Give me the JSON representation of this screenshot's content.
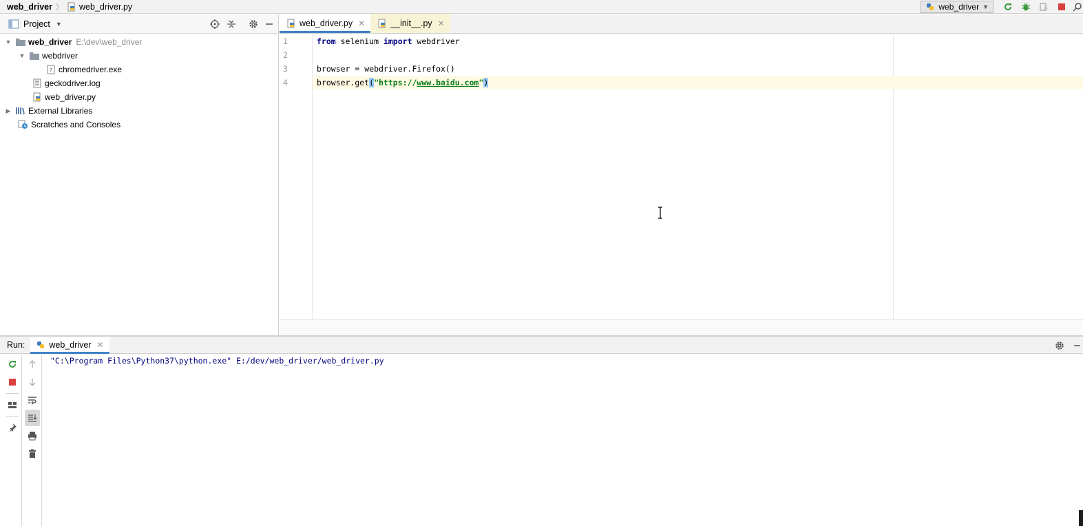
{
  "navbar": {
    "project_name": "web_driver",
    "current_file": "web_driver.py",
    "run_config": "web_driver"
  },
  "project_panel": {
    "title": "Project",
    "tree": [
      {
        "label": "web_driver",
        "path": "E:\\dev\\web_driver",
        "level": 0,
        "expanded": true,
        "type": "folder"
      },
      {
        "label": "webdriver",
        "level": 1,
        "expanded": true,
        "type": "folder"
      },
      {
        "label": "chromedriver.exe",
        "level": 2,
        "type": "exe"
      },
      {
        "label": "geckodriver.log",
        "level": 1,
        "type": "log"
      },
      {
        "label": "web_driver.py",
        "level": 1,
        "type": "python"
      },
      {
        "label": "External Libraries",
        "level": 0,
        "expanded": false,
        "type": "library"
      },
      {
        "label": "Scratches and Consoles",
        "level": 0,
        "type": "scratch"
      }
    ]
  },
  "editor": {
    "tabs": [
      {
        "label": "web_driver.py",
        "active": true
      },
      {
        "label": "__init__.py",
        "active": false
      }
    ],
    "line_numbers": [
      "1",
      "2",
      "3",
      "4"
    ],
    "code": {
      "line1_kw1": "from",
      "line1_mid": " selenium ",
      "line1_kw2": "import",
      "line1_end": " webdriver",
      "line3": "browser = webdriver.Firefox()",
      "line4_pre": "browser.get",
      "line4_open": "(",
      "line4_q1": "\"https://",
      "line4_url": "www.baidu.com",
      "line4_q2": "\"",
      "line4_close": ")"
    }
  },
  "run_panel": {
    "label": "Run:",
    "tab": "web_driver",
    "console_output": "\"C:\\Program Files\\Python37\\python.exe\" E:/dev/web_driver/web_driver.py"
  },
  "colors": {
    "accent": "#4083c9",
    "keyword": "#000080",
    "string": "#067d17",
    "run_green": "#3c9a3c",
    "stop_red": "#d94040"
  }
}
